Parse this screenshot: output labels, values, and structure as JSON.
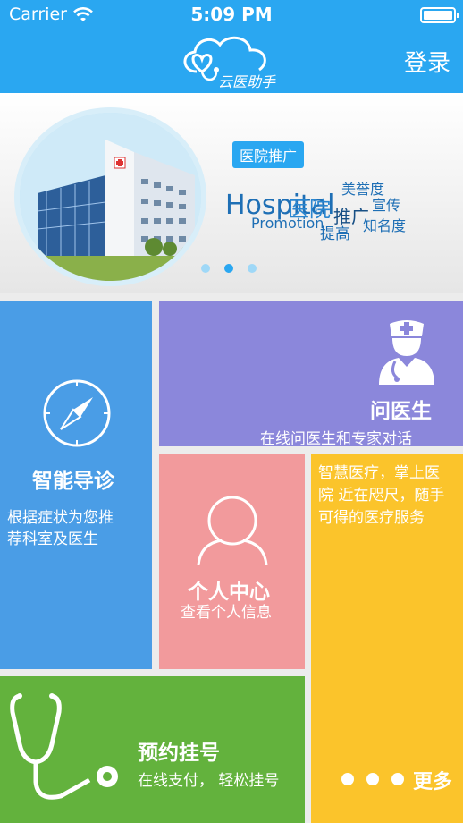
{
  "status_bar": {
    "carrier": "Carrier",
    "time": "5:09 PM"
  },
  "header": {
    "app_name": "云医助手",
    "login_label": "登录",
    "background_color": "#2aa7f1"
  },
  "banner": {
    "tag": "医院推广",
    "words": {
      "hospital": "Hospital",
      "yiyuan": "医院",
      "meiyudu": "美誉度",
      "xuanchuan": "宣传",
      "tuiguang": "推广",
      "promotion": "Promotion",
      "tigao": "提高",
      "zhimingdu": "知名度"
    },
    "page_count": 3,
    "active_page": 2
  },
  "tiles": {
    "triage": {
      "title": "智能导诊",
      "line1": "根据症状为您推",
      "line2": "荐科室及医生",
      "color": "#4a9de6",
      "icon": "compass-icon"
    },
    "ask_doctor": {
      "title": "问医生",
      "subtitle": "在线问医生和专家对话",
      "color": "#8b87db",
      "icon": "doctor-icon"
    },
    "personal": {
      "title": "个人中心",
      "subtitle": "查看个人信息",
      "color": "#f29a9c",
      "icon": "user-icon"
    },
    "info": {
      "line1": "智慧医疗，掌上医",
      "line2": "院 近在咫尺，随手",
      "line3": "可得的医疗服务",
      "more_label": "更多",
      "color": "#fbc42b"
    },
    "booking": {
      "title": "预约挂号",
      "subtitle": "在线支付，  轻松挂号",
      "color": "#63b23d",
      "icon": "stethoscope-icon"
    }
  }
}
